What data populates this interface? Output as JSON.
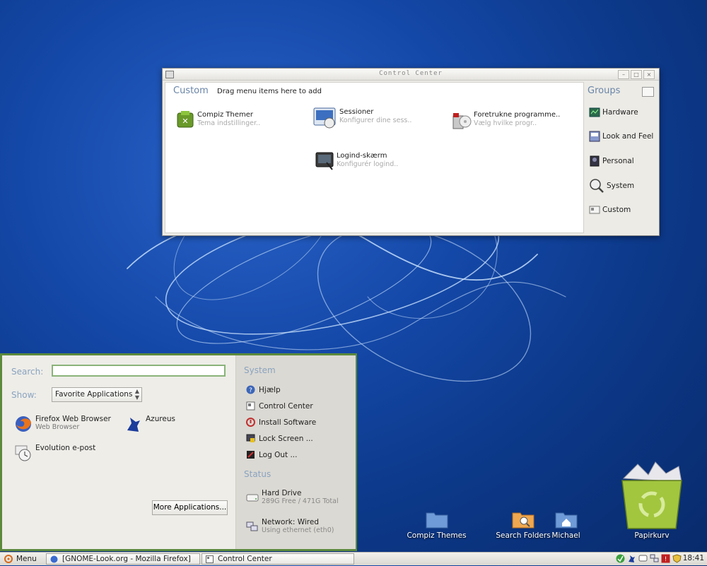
{
  "control_center": {
    "title": "Control Center",
    "custom_heading": "Custom",
    "custom_hint": "Drag menu items here to add",
    "apps": [
      {
        "name": "Compiz Themer",
        "desc": "Tema indstillinger.."
      },
      {
        "name": "Sessioner",
        "desc": "Konfigurer dine sess.."
      },
      {
        "name": "Foretrukne programme..",
        "desc": "Vælg hvilke progr.."
      },
      {
        "name": "Logind-skærm",
        "desc": "Konfigurér logind.."
      }
    ],
    "groups_heading": "Groups",
    "groups": [
      "Hardware",
      "Look and Feel",
      "Personal",
      "System",
      "Custom"
    ]
  },
  "desktop_icons": [
    "Compiz Themes",
    "Search Folders",
    "Michael",
    "Papirkurv"
  ],
  "menu": {
    "search_label": "Search:",
    "search_value": "",
    "show_label": "Show:",
    "show_selected": "Favorite Applications",
    "apps": [
      {
        "name": "Firefox Web Browser",
        "sub": "Web Browser"
      },
      {
        "name": "Azureus",
        "sub": ""
      },
      {
        "name": "Evolution e-post",
        "sub": ""
      }
    ],
    "more_button": "More Applications...",
    "system_heading": "System",
    "system_items": [
      "Hjælp",
      "Control Center",
      "Install Software",
      "Lock Screen ...",
      "Log Out ..."
    ],
    "status_heading": "Status",
    "status": [
      {
        "name": "Hard Drive",
        "sub": "289G Free / 471G Total"
      },
      {
        "name": "Network: Wired",
        "sub": "Using ethernet (eth0)"
      }
    ]
  },
  "taskbar": {
    "menu_label": "Menu",
    "tasks": [
      "[GNOME-Look.org - Mozilla Firefox]",
      "Control Center"
    ],
    "clock": "18:41"
  },
  "colors": {
    "menu_border": "#5c8a3c",
    "heading_blue": "#6a85a8",
    "desktop_blue": "#1448a8"
  }
}
